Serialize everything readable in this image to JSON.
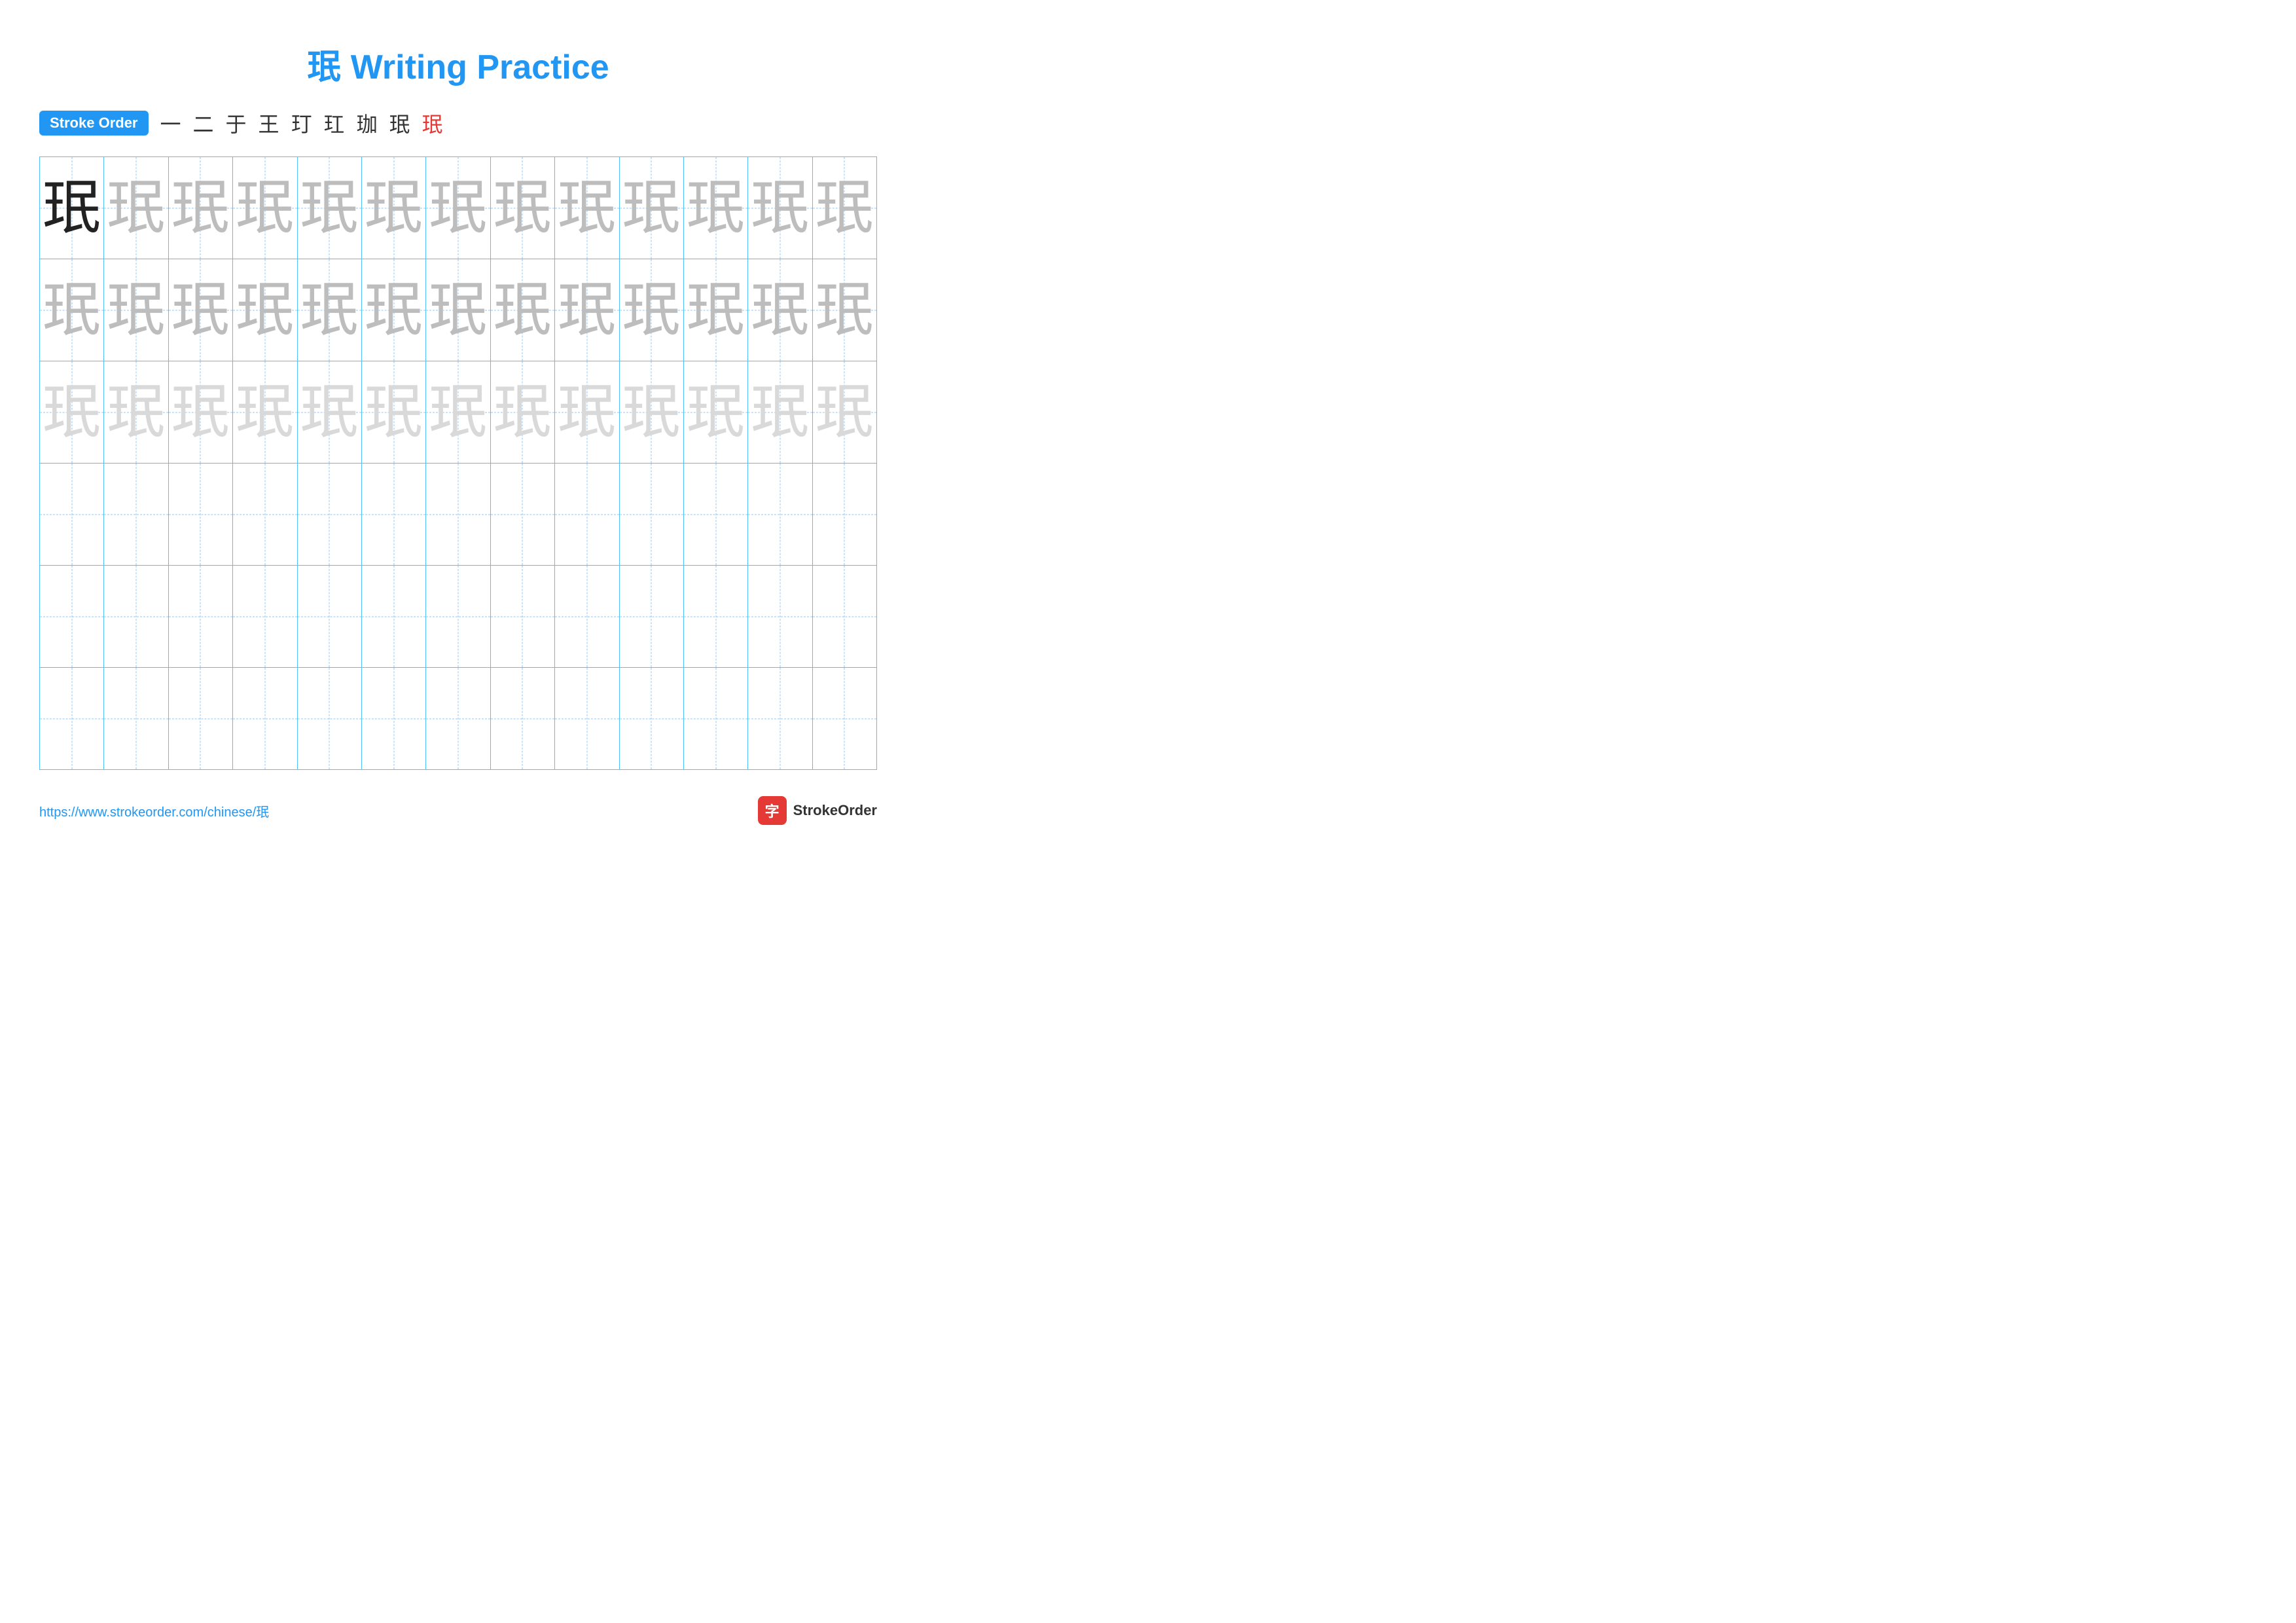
{
  "title": "珉 Writing Practice",
  "stroke_order_label": "Stroke Order",
  "stroke_chars": [
    "一",
    "二",
    "于",
    "王",
    "玎",
    "玒",
    "珈",
    "珉̄",
    "珉"
  ],
  "stroke_chars_display": [
    {
      "char": "一",
      "red": false
    },
    {
      "char": "二",
      "red": false
    },
    {
      "char": "于",
      "red": false
    },
    {
      "char": "王",
      "red": false
    },
    {
      "char": "玎",
      "red": false
    },
    {
      "char": "玒",
      "red": false
    },
    {
      "char": "珈",
      "red": false
    },
    {
      "char": "珉",
      "red": false
    },
    {
      "char": "珉",
      "red": true
    }
  ],
  "main_char": "珉",
  "rows": [
    {
      "cells": [
        "dark",
        "medium",
        "medium",
        "medium",
        "medium",
        "medium",
        "medium",
        "medium",
        "medium",
        "medium",
        "medium",
        "medium",
        "medium"
      ]
    },
    {
      "cells": [
        "medium",
        "medium",
        "medium",
        "medium",
        "medium",
        "medium",
        "medium",
        "medium",
        "medium",
        "medium",
        "medium",
        "medium",
        "medium"
      ]
    },
    {
      "cells": [
        "light",
        "light",
        "light",
        "light",
        "light",
        "light",
        "light",
        "light",
        "light",
        "light",
        "light",
        "light",
        "light"
      ]
    },
    {
      "cells": [
        "empty",
        "empty",
        "empty",
        "empty",
        "empty",
        "empty",
        "empty",
        "empty",
        "empty",
        "empty",
        "empty",
        "empty",
        "empty"
      ]
    },
    {
      "cells": [
        "empty",
        "empty",
        "empty",
        "empty",
        "empty",
        "empty",
        "empty",
        "empty",
        "empty",
        "empty",
        "empty",
        "empty",
        "empty"
      ]
    },
    {
      "cells": [
        "empty",
        "empty",
        "empty",
        "empty",
        "empty",
        "empty",
        "empty",
        "empty",
        "empty",
        "empty",
        "empty",
        "empty",
        "empty"
      ]
    }
  ],
  "footer": {
    "url": "https://www.strokeorder.com/chinese/珉",
    "brand_name": "StrokeOrder",
    "brand_icon": "字"
  }
}
